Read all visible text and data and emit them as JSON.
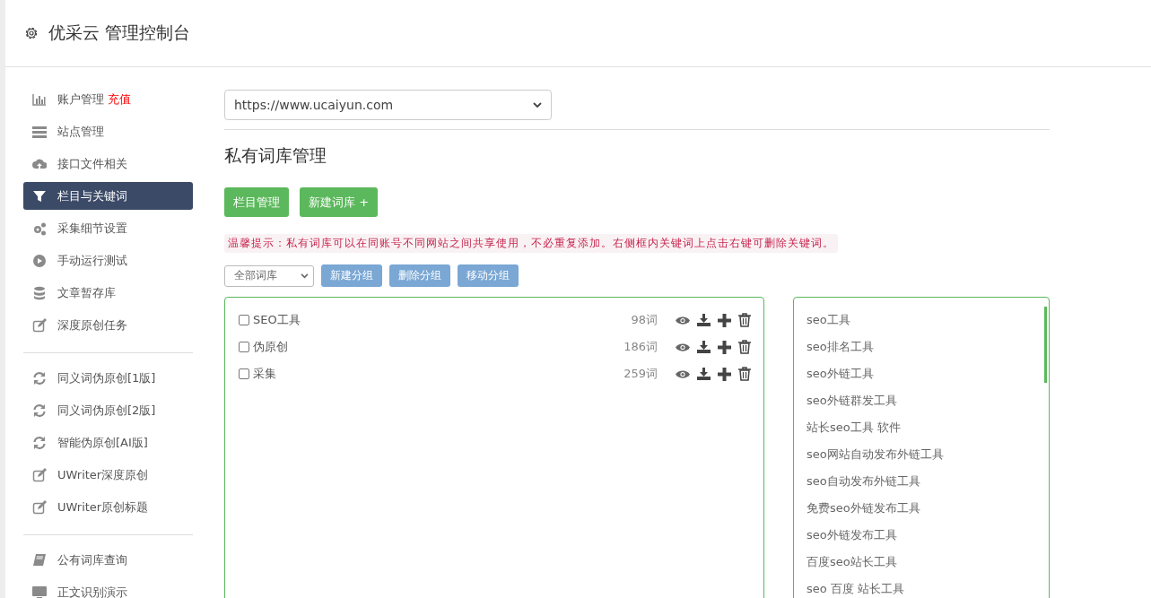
{
  "header": {
    "title": "优采云 管理控制台"
  },
  "sidebar": {
    "groups": [
      {
        "items": [
          {
            "label": "账户管理",
            "badge": "充值",
            "selected": false
          },
          {
            "label": "站点管理",
            "selected": false
          },
          {
            "label": "接口文件相关",
            "selected": false
          },
          {
            "label": "栏目与关键词",
            "selected": true
          },
          {
            "label": "采集细节设置",
            "selected": false
          },
          {
            "label": "手动运行测试",
            "selected": false
          },
          {
            "label": "文章暂存库",
            "selected": false
          },
          {
            "label": "深度原创任务",
            "selected": false
          }
        ]
      },
      {
        "items": [
          {
            "label": "同义词伪原创[1版]",
            "selected": false
          },
          {
            "label": "同义词伪原创[2版]",
            "selected": false
          },
          {
            "label": "智能伪原创[AI版]",
            "selected": false
          },
          {
            "label": "UWriter深度原创",
            "selected": false
          },
          {
            "label": "UWriter原创标题",
            "selected": false
          }
        ]
      },
      {
        "items": [
          {
            "label": "公有词库查询",
            "selected": false
          },
          {
            "label": "正文识别演示",
            "selected": false
          }
        ]
      }
    ]
  },
  "site_select": {
    "value": "https://www.ucaiyun.com"
  },
  "section_title": "私有词库管理",
  "action_buttons": [
    "栏目管理",
    "新建词库 +"
  ],
  "notice": "温馨提示：私有词库可以在同账号不同网站之间共享使用，不必重复添加。右侧框内关键词上点击右键可删除关键词。",
  "toolbar": {
    "filter": {
      "value": "全部词库"
    },
    "buttons": [
      {
        "label": "新建分组",
        "disabled": true
      },
      {
        "label": "删除分组",
        "disabled": true
      },
      {
        "label": "移动分组",
        "disabled": true
      }
    ]
  },
  "libraries": [
    {
      "name": "SEO工具",
      "count": "98词",
      "checked": false
    },
    {
      "name": "伪原创",
      "count": "186词",
      "checked": false
    },
    {
      "name": "采集",
      "count": "259词",
      "checked": false
    }
  ],
  "keywords": [
    "seo工具",
    "seo排名工具",
    "seo外链工具",
    "seo外链群发工具",
    "站长seo工具 软件",
    "seo网站自动发布外链工具",
    "seo自动发布外链工具",
    "免费seo外链发布工具",
    "seo外链发布工具",
    "百度seo站长工具",
    "seo 百度 站长工具"
  ]
}
